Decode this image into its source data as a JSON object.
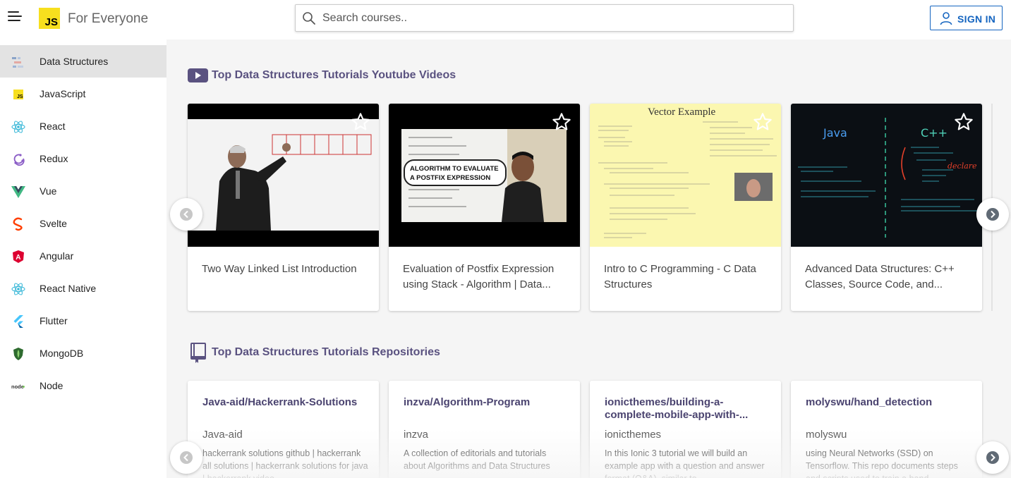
{
  "header": {
    "logo_text": "JS",
    "brand": "For Everyone",
    "search_placeholder": "Search courses..",
    "signin_label": "SIGN IN"
  },
  "sidebar": {
    "items": [
      {
        "label": "Data Structures",
        "icon": "data-structures-icon",
        "active": true
      },
      {
        "label": "JavaScript",
        "icon": "javascript-icon"
      },
      {
        "label": "React",
        "icon": "react-icon"
      },
      {
        "label": "Redux",
        "icon": "redux-icon"
      },
      {
        "label": "Vue",
        "icon": "vue-icon"
      },
      {
        "label": "Svelte",
        "icon": "svelte-icon"
      },
      {
        "label": "Angular",
        "icon": "angular-icon"
      },
      {
        "label": "React Native",
        "icon": "react-native-icon"
      },
      {
        "label": "Flutter",
        "icon": "flutter-icon"
      },
      {
        "label": "MongoDB",
        "icon": "mongodb-icon"
      },
      {
        "label": "Node",
        "icon": "node-icon"
      }
    ]
  },
  "videos": {
    "title": "Top Data Structures Tutorials Youtube Videos",
    "items": [
      {
        "title": "Two Way Linked List Introduction"
      },
      {
        "title": "Evaluation of Postfix Expression using Stack - Algorithm | Data..."
      },
      {
        "title": "Intro to C Programming - C Data Structures"
      },
      {
        "title": "Advanced Data Structures: C++ Classes, Source Code, and..."
      }
    ],
    "thumb2_caption": "ALGORITHM TO EVALUATE A POSTFIX EXPRESSION",
    "thumb3_caption": "Vector Example",
    "thumb4_left": "Java",
    "thumb4_right": "C++",
    "thumb4_note": "declare"
  },
  "repos": {
    "title": "Top Data Structures Tutorials Repositories",
    "items": [
      {
        "name": "Java-aid/Hackerrank-Solutions",
        "owner": "Java-aid",
        "desc": "hackerrank solutions github | hackerrank all solutions | hackerrank solutions for java | hackerrank video"
      },
      {
        "name": "inzva/Algorithm-Program",
        "owner": "inzva",
        "desc": "A collection of editorials and tutorials about Algorithms and Data Structures"
      },
      {
        "name": "ionicthemes/building-a-complete-mobile-app-with-...",
        "owner": "ionicthemes",
        "desc": "In this Ionic 3 tutorial we will build an example app with a question and answer format (Q&A), similar to"
      },
      {
        "name": "molyswu/hand_detection",
        "owner": "molyswu",
        "desc": "using Neural Networks (SSD) on Tensorflow. This repo documents steps and scripts used to train a hand"
      }
    ]
  },
  "colors": {
    "accent": "#5a5280",
    "signin": "#1565c0",
    "logo": "#f7df1e"
  }
}
